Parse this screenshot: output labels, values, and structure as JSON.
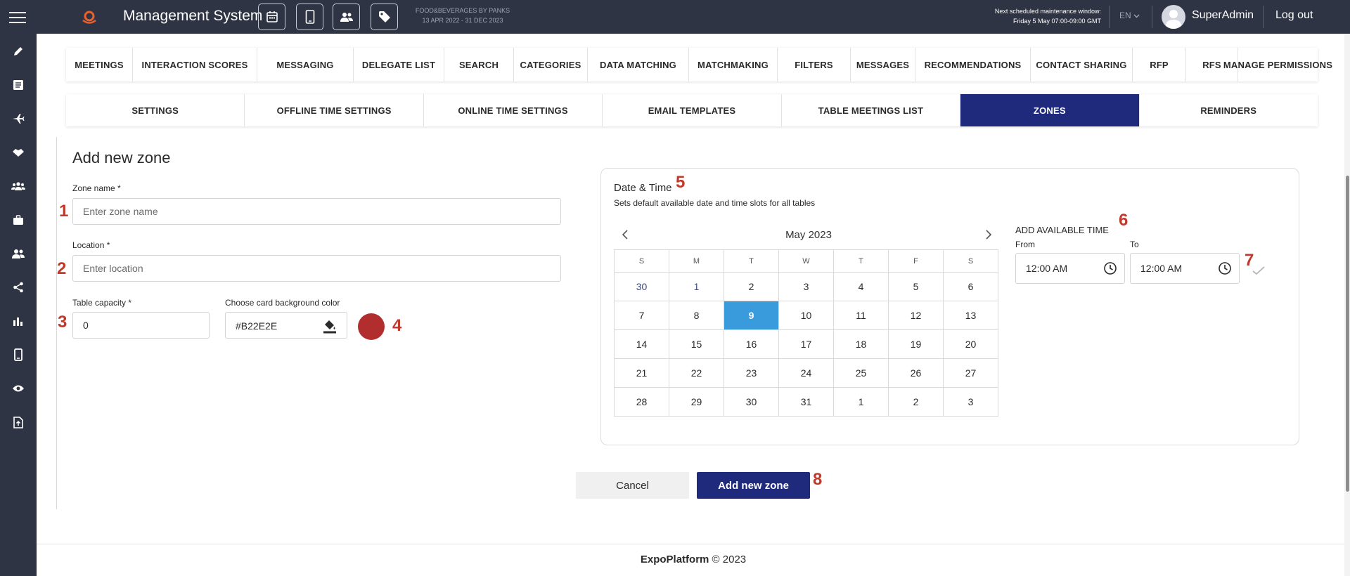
{
  "header": {
    "app_title": "Management System",
    "event_name": "FOOD&BEVERAGES BY PANKS",
    "event_dates": "13 APR 2022 - 31 DEC 2023",
    "maintenance_title": "Next scheduled maintenance window:",
    "maintenance_time": "Friday 5 May 07:00-09:00 GMT",
    "language": "EN",
    "user_name": "SuperAdmin",
    "logout_label": "Log out",
    "toolbar_icons": [
      "calendar-icon",
      "mobile-icon",
      "users-icon",
      "tag-icon"
    ]
  },
  "sidebar": {
    "icons": [
      "pencil-icon",
      "list-icon",
      "plane-icon",
      "handshake-icon",
      "group-icon",
      "briefcase-icon",
      "people-icon",
      "share-icon",
      "bar-chart-icon",
      "mobile-icon",
      "eye-icon",
      "file-export-icon"
    ]
  },
  "nav_primary": [
    "MEETINGS",
    "INTERACTION SCORES",
    "MESSAGING",
    "DELEGATE LIST",
    "SEARCH",
    "CATEGORIES",
    "DATA MATCHING",
    "MATCHMAKING",
    "FILTERS",
    "MESSAGES",
    "RECOMMENDATIONS",
    "CONTACT SHARING",
    "RFP",
    "RFS",
    "MANAGE PERMISSIONS"
  ],
  "nav_secondary": [
    "SETTINGS",
    "OFFLINE TIME SETTINGS",
    "ONLINE TIME SETTINGS",
    "EMAIL TEMPLATES",
    "TABLE MEETINGS LIST",
    "ZONES",
    "REMINDERS"
  ],
  "nav_secondary_active": "ZONES",
  "form": {
    "heading": "Add new zone",
    "zone_name_label": "Zone name *",
    "zone_name_placeholder": "Enter zone name",
    "location_label": "Location *",
    "location_placeholder": "Enter location",
    "capacity_label": "Table capacity *",
    "capacity_value": "0",
    "color_label": "Choose card background color",
    "color_value": "#B22E2E",
    "cancel_label": "Cancel",
    "submit_label": "Add new zone"
  },
  "date_time": {
    "title": "Date & Time",
    "subtitle": "Sets default available date and time slots for all tables",
    "month": "May 2023",
    "weekdays": [
      "S",
      "M",
      "T",
      "W",
      "T",
      "F",
      "S"
    ],
    "weeks": [
      [
        "30",
        "1",
        "2",
        "3",
        "4",
        "5",
        "6"
      ],
      [
        "7",
        "8",
        "9",
        "10",
        "11",
        "12",
        "13"
      ],
      [
        "14",
        "15",
        "16",
        "17",
        "18",
        "19",
        "20"
      ],
      [
        "21",
        "22",
        "23",
        "24",
        "25",
        "26",
        "27"
      ],
      [
        "28",
        "29",
        "30",
        "31",
        "1",
        "2",
        "3"
      ]
    ],
    "selected_day": "9",
    "avail_title": "ADD AVAILABLE TIME",
    "from_label": "From",
    "from_value": "12:00 AM",
    "to_label": "To",
    "to_value": "12:00 AM"
  },
  "annotations": [
    "1",
    "2",
    "3",
    "4",
    "5",
    "6",
    "7",
    "8"
  ],
  "footer": {
    "brand": "ExpoPlatform",
    "copyright": "© 2023"
  },
  "colors": {
    "topbar": "#2f3444",
    "primary": "#1f2a7c",
    "selected_day": "#3a9bdc",
    "annotation": "#c0392b",
    "zone_color": "#B22E2E"
  }
}
